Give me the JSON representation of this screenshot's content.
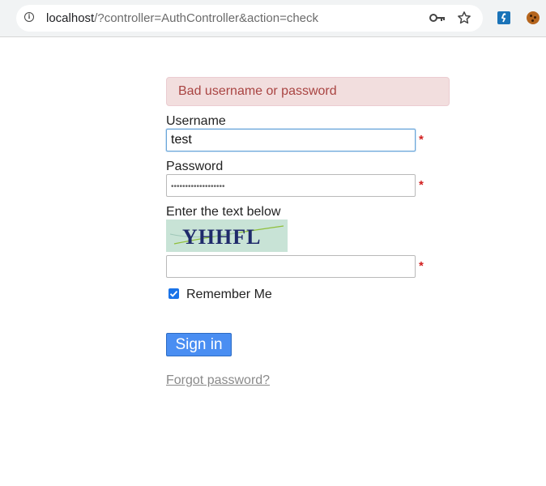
{
  "browser": {
    "url_host": "localhost",
    "url_path": "/?controller=AuthController&action=check"
  },
  "login": {
    "error_message": "Bad username or password",
    "username_label": "Username",
    "username_value": "test",
    "password_label": "Password",
    "password_masked": "•••••••••••••••••••",
    "captcha_label": "Enter the text below",
    "captcha_text": "YHHFL",
    "captcha_value": "",
    "required_marker": "*",
    "remember_label": "Remember Me",
    "remember_checked": true,
    "signin_label": "Sign in",
    "forgot_label": "Forgot password?"
  },
  "colors": {
    "alert_bg": "#f2dede",
    "alert_text": "#a94442",
    "button_bg": "#4a8ef2",
    "required": "#d21f1f",
    "link": "#8a8a8a"
  }
}
